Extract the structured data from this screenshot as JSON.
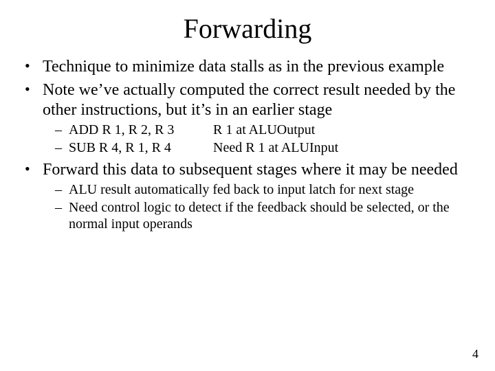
{
  "title": "Forwarding",
  "bullets": {
    "b1": "Technique to minimize data stalls as in the previous example",
    "b2": "Note we’ve actually computed the correct result needed by the other instructions, but it’s in an earlier stage",
    "b2_sub": {
      "row1_left": "ADD R 1, R 2, R 3",
      "row1_right": "R 1 at ALUOutput",
      "row2_left": "SUB R 4, R 1, R 4",
      "row2_right": "Need R 1 at ALUInput"
    },
    "b3": "Forward this data to subsequent stages where it may be needed",
    "b3_sub": {
      "s1": "ALU result automatically fed back to input latch for next stage",
      "s2": "Need control logic to detect if the feedback should be selected, or the normal input operands"
    }
  },
  "page_number": "4"
}
